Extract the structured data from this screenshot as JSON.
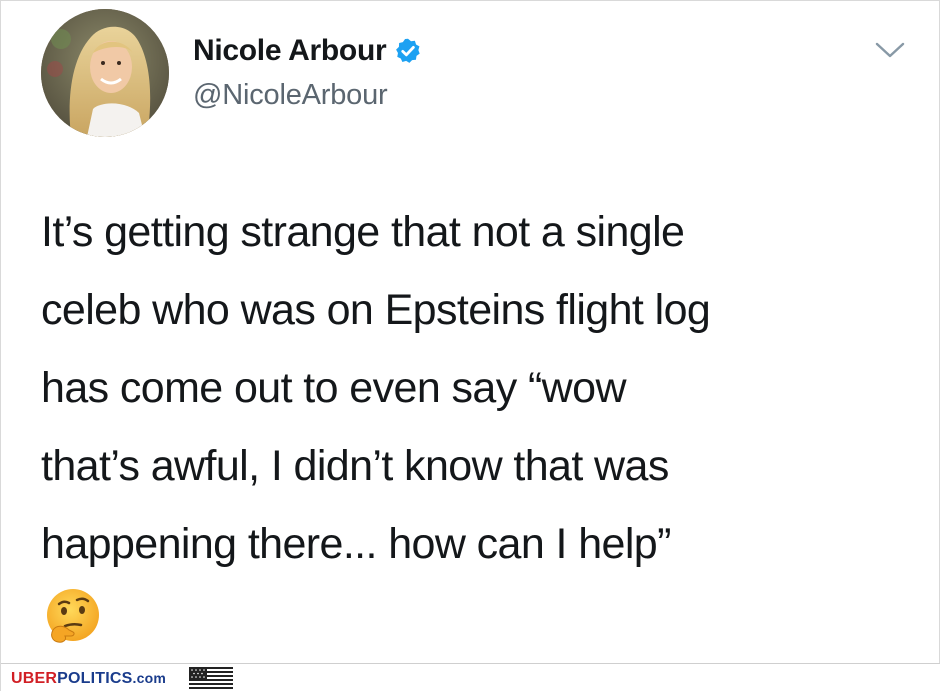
{
  "tweet": {
    "display_name": "Nicole Arbour",
    "handle": "@NicoleArbour",
    "verified": true,
    "text_lines": [
      "It’s getting strange that not a single",
      "celeb who was on Epsteins flight log",
      "has come out to even say “wow",
      "that’s awful, I didn’t know that was",
      "happening there... how can I help”"
    ],
    "emoji": "thinking-face"
  },
  "footer": {
    "brand_part1": "UBER",
    "brand_part2": "POLITICS",
    "brand_part3": ".com",
    "flag_icon": "usa-flag"
  },
  "colors": {
    "text": "#14171a",
    "handle": "#5b6670",
    "verified": "#1da1f2",
    "brand_red": "#d11f25",
    "brand_blue": "#1a3c8c"
  }
}
